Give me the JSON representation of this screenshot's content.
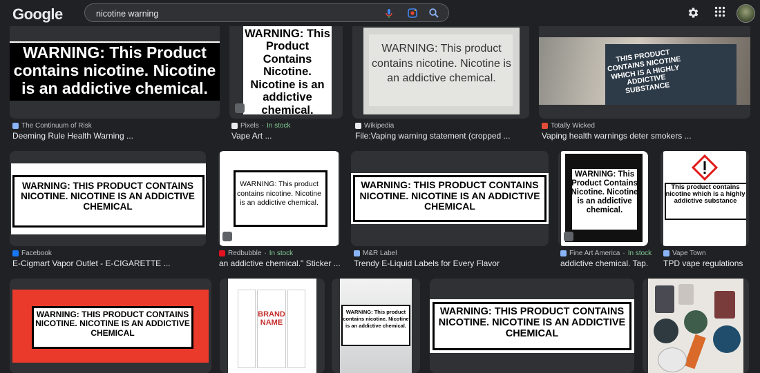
{
  "header": {
    "logo": "Google",
    "query": "nicotine warning"
  },
  "rows": [
    [
      {
        "source": "The Continuum of Risk",
        "stock": "",
        "title": "Deeming Rule Health Warning ...",
        "text": "WARNING: This Product contains nicotine. Nicotine is an addictive chemical."
      },
      {
        "source": "Pixels",
        "stock": "In stock",
        "title": "Vape Art ...",
        "text": "WARNING: This Product Contains Nicotine. Nicotine is an addictive chemical."
      },
      {
        "source": "Wikipedia",
        "stock": "",
        "title": "File:Vaping warning statement (cropped ...",
        "text": "WARNING: This product contains nicotine. Nicotine is an addictive chemical."
      },
      {
        "source": "Totally Wicked",
        "stock": "",
        "title": "Vaping health warnings deter smokers ...",
        "text": "THIS PRODUCT CONTAINS NICOTINE WHICH IS A HIGHLY ADDICTIVE SUBSTANCE"
      }
    ],
    [
      {
        "source": "Facebook",
        "stock": "",
        "title": "E-Cigmart Vapor Outlet - E-CIGARETTE ...",
        "text": "WARNING: THIS PRODUCT CONTAINS NICOTINE. NICOTINE IS AN ADDICTIVE CHEMICAL"
      },
      {
        "source": "Redbubble",
        "stock": "In stock",
        "title": "an addictive chemical.\" Sticker ...",
        "text": "WARNING: This product contains nicotine. Nicotine is an addictive chemical."
      },
      {
        "source": "M&R Label",
        "stock": "",
        "title": "Trendy E-Liquid Labels for Every Flavor",
        "text": "WARNING: THIS PRODUCT CONTAINS NICOTINE. NICOTINE IS AN ADDICTIVE CHEMICAL"
      },
      {
        "source": "Fine Art America",
        "stock": "In stock",
        "title": "addictive chemical. Tap...",
        "text": "WARNING: This Product Contains Nicotine. Nicotine is an addictive chemical."
      },
      {
        "source": "Vape Town",
        "stock": "",
        "title": "TPD vape regulations",
        "text": "This product contains nicotine which is a highly addictive substance"
      }
    ],
    [
      {
        "text": "WARNING: THIS PRODUCT CONTAINS NICOTINE. NICOTINE IS AN ADDICTIVE CHEMICAL"
      },
      {
        "text": "BRAND NAME"
      },
      {
        "text": "WARNING: This product contains nicotine. Nicotine is an addictive chemical."
      },
      {
        "text": "WARNING: THIS PRODUCT CONTAINS NICOTINE. NICOTINE IS AN ADDICTIVE CHEMICAL"
      },
      {
        "text": ""
      }
    ]
  ],
  "colors": {
    "bg": "#202124",
    "card": "#303134",
    "stock": "#81c995"
  }
}
